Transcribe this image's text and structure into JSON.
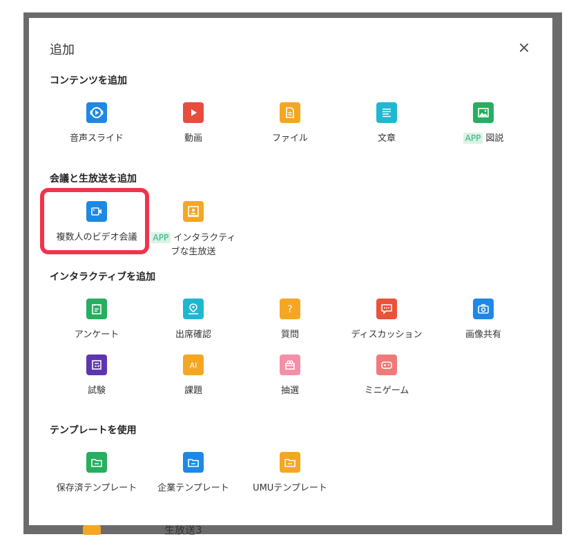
{
  "modal": {
    "title": "追加",
    "close_glyph": "×"
  },
  "background": {
    "peek_text": "生放送3"
  },
  "sections": {
    "content": {
      "title": "コンテンツを追加",
      "items": [
        {
          "label": "音声スライド",
          "icon": "audio-slide-icon",
          "color": "#1e88e5"
        },
        {
          "label": "動画",
          "icon": "video-play-icon",
          "color": "#e74c3c"
        },
        {
          "label": "ファイル",
          "icon": "file-icon",
          "color": "#f5a623"
        },
        {
          "label": "文章",
          "icon": "article-icon",
          "color": "#1fb8d0"
        },
        {
          "label": "図説",
          "tag": "APP",
          "icon": "image-icon",
          "color": "#27ae60"
        }
      ]
    },
    "meeting": {
      "title": "会議と生放送を追加",
      "items": [
        {
          "label": "複数人のビデオ会議",
          "icon": "video-conference-icon",
          "color": "#1e88e5"
        },
        {
          "label": "インタラクティブな生放送",
          "tag": "APP",
          "icon": "live-broadcast-icon",
          "color": "#f5a623"
        }
      ]
    },
    "interactive": {
      "title": "インタラクティブを追加",
      "items": [
        {
          "label": "アンケート",
          "icon": "survey-icon",
          "color": "#27ae60"
        },
        {
          "label": "出席確認",
          "icon": "location-checkin-icon",
          "color": "#1fb8d0"
        },
        {
          "label": "質問",
          "icon": "question-icon",
          "color": "#f5a623"
        },
        {
          "label": "ディスカッション",
          "icon": "discussion-icon",
          "color": "#e8533a"
        },
        {
          "label": "画像共有",
          "icon": "camera-icon",
          "color": "#1e88e5"
        },
        {
          "label": "試験",
          "icon": "exam-icon",
          "color": "#5e35b1"
        },
        {
          "label": "課題",
          "icon": "assignment-ai-icon",
          "color": "#f5a623"
        },
        {
          "label": "抽選",
          "icon": "lottery-icon",
          "color": "#f48fa8"
        },
        {
          "label": "ミニゲーム",
          "icon": "gamepad-icon",
          "color": "#f07a7a"
        }
      ]
    },
    "template": {
      "title": "テンプレートを使用",
      "items": [
        {
          "label": "保存済テンプレート",
          "icon": "folder-icon",
          "color": "#27ae60"
        },
        {
          "label": "企業テンプレート",
          "icon": "folder-icon",
          "color": "#1e88e5"
        },
        {
          "label": "UMUテンプレート",
          "icon": "folder-icon",
          "color": "#f5a623"
        }
      ]
    }
  }
}
